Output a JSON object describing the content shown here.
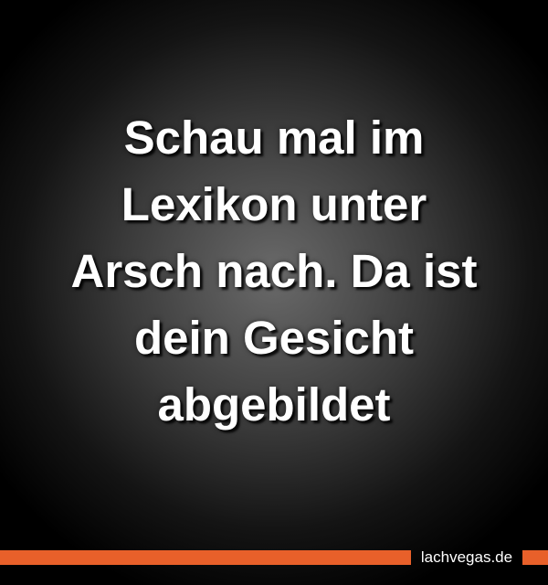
{
  "quote": {
    "lines": [
      "Schau mal im",
      "Lexikon unter",
      "Arsch nach. Da ist",
      "dein Gesicht",
      "abgebildet"
    ]
  },
  "footer": {
    "brand": "lachvegas.de",
    "accent_color": "#e8602a"
  }
}
